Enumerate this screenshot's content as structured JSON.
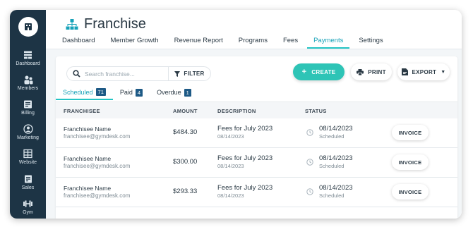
{
  "app": {
    "page_title": "Franchise"
  },
  "sidebar": {
    "logo_icon": "building-icon",
    "items": [
      {
        "label": "Dashboard",
        "icon": "dashboard-icon"
      },
      {
        "label": "Members",
        "icon": "members-icon"
      },
      {
        "label": "Billing",
        "icon": "billing-icon"
      },
      {
        "label": "Marketing",
        "icon": "marketing-icon"
      },
      {
        "label": "Website",
        "icon": "website-icon"
      },
      {
        "label": "Sales",
        "icon": "sales-icon"
      },
      {
        "label": "Gym",
        "icon": "dumbbell-icon"
      }
    ]
  },
  "nav": {
    "tabs": [
      {
        "label": "Dashboard"
      },
      {
        "label": "Member Growth"
      },
      {
        "label": "Revenue Report"
      },
      {
        "label": "Programs"
      },
      {
        "label": "Fees"
      },
      {
        "label": "Payments",
        "active": true
      },
      {
        "label": "Settings"
      }
    ]
  },
  "toolbar": {
    "search_placeholder": "Search franchise...",
    "filter_label": "FILTER",
    "create_label": "CREATE",
    "print_label": "PRINT",
    "export_label": "EXPORT"
  },
  "subtabs": [
    {
      "label": "Scheduled",
      "count": "71",
      "active": true
    },
    {
      "label": "Paid",
      "count": "4"
    },
    {
      "label": "Overdue",
      "count": "1"
    }
  ],
  "table": {
    "headers": {
      "franchisee": "FRANCHISEE",
      "amount": "AMOUNT",
      "description": "DESCRIPTION",
      "status": "STATUS"
    },
    "rows": [
      {
        "name": "Franchisee Name",
        "email": "franchisee@gymdesk.com",
        "amount": "$484.30",
        "description": "Fees for July 2023",
        "description_date": "08/14/2023",
        "status_date": "08/14/2023",
        "status": "Scheduled",
        "action": "INVOICE"
      },
      {
        "name": "Franchisee Name",
        "email": "franchisee@gymdesk.com",
        "amount": "$300.00",
        "description": "Fees for July 2023",
        "description_date": "08/14/2023",
        "status_date": "08/14/2023",
        "status": "Scheduled",
        "action": "INVOICE"
      },
      {
        "name": "Franchisee Name",
        "email": "franchisee@gymdesk.com",
        "amount": "$293.33",
        "description": "Fees for July 2023",
        "description_date": "08/14/2023",
        "status_date": "08/14/2023",
        "status": "Scheduled",
        "action": "INVOICE"
      }
    ]
  },
  "colors": {
    "sidebar_bg": "#1d3445",
    "accent": "#2ec4b6",
    "active_tab": "#17a2b8",
    "badge": "#1e5a86"
  }
}
